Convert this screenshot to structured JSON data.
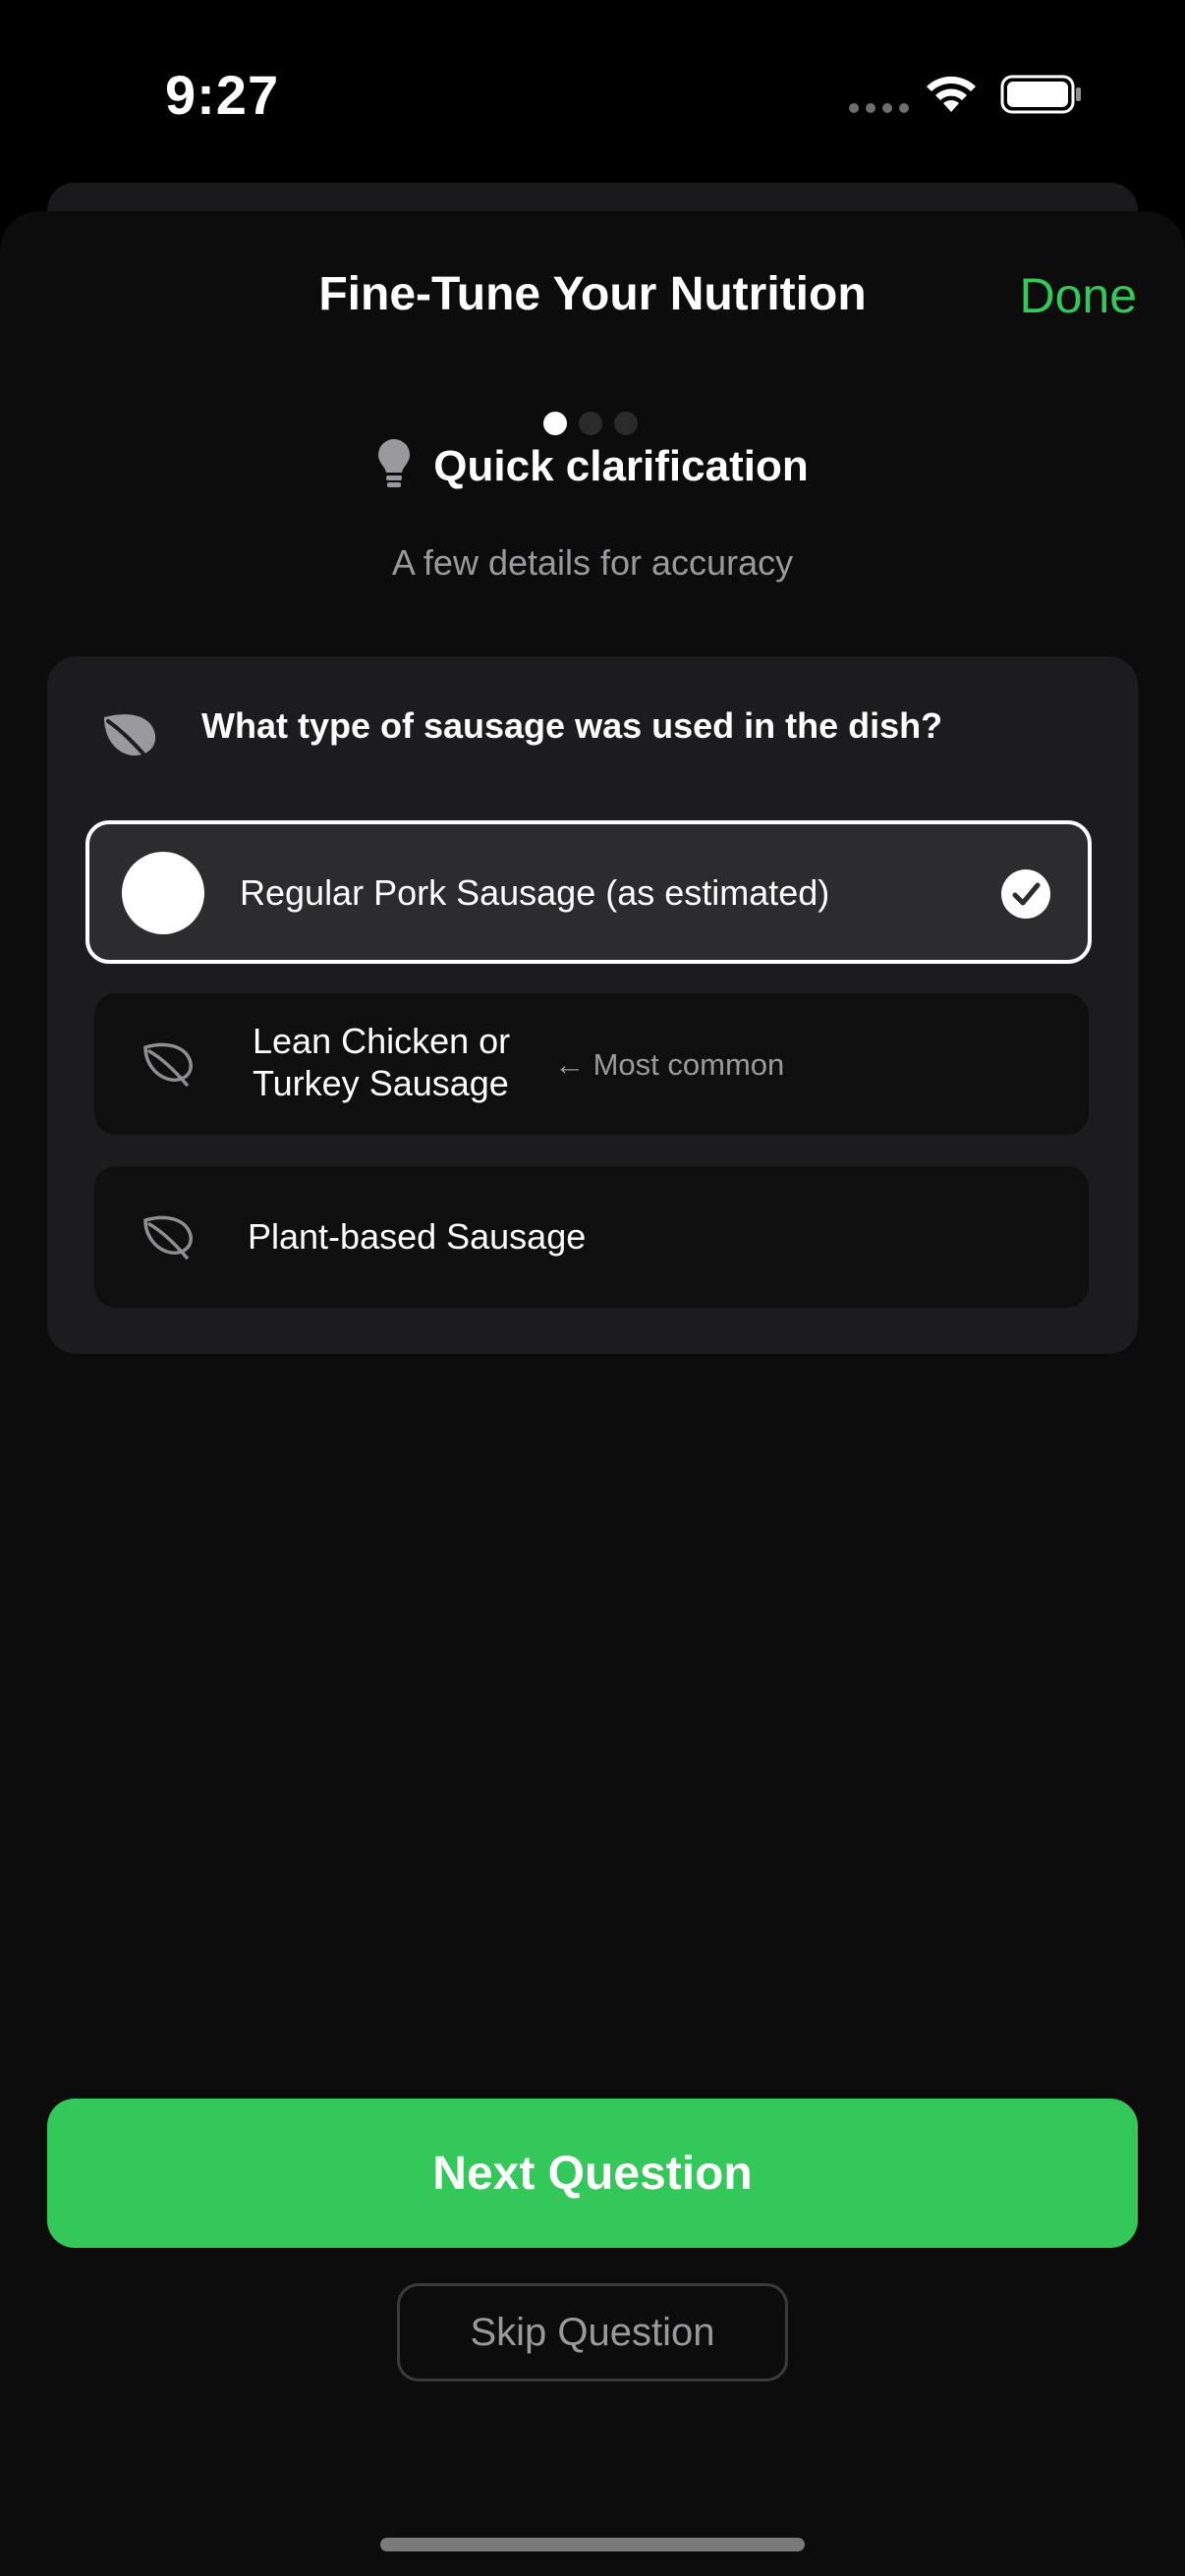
{
  "status_bar": {
    "time": "9:27",
    "wifi_icon": "wifi-icon",
    "battery_icon": "battery-icon"
  },
  "sheet": {
    "title": "Fine-Tune Your Nutrition",
    "done_label": "Done",
    "page_indicator": {
      "total": 3,
      "current": 1
    },
    "clarification_title": "Quick clarification",
    "clarification_icon": "lightbulb-icon",
    "clarification_subtitle": "A few details for accuracy"
  },
  "question": {
    "icon": "leaf-icon",
    "text": "What type of sausage was used in the dish?",
    "options": [
      {
        "label": "Regular Pork Sausage (as estimated)",
        "selected": true,
        "icon": "circle-icon"
      },
      {
        "label": "Lean Chicken or Turkey Sausage",
        "selected": false,
        "icon": "leaf-icon",
        "hint": "← Most common"
      },
      {
        "label": "Plant-based Sausage",
        "selected": false,
        "icon": "leaf-icon"
      }
    ]
  },
  "actions": {
    "next_label": "Next Question",
    "skip_label": "Skip Question"
  },
  "colors": {
    "accent": "#34c759",
    "background": "#0c0c0c",
    "card": "#1c1c1e",
    "selected_option": "#2c2c2e"
  }
}
